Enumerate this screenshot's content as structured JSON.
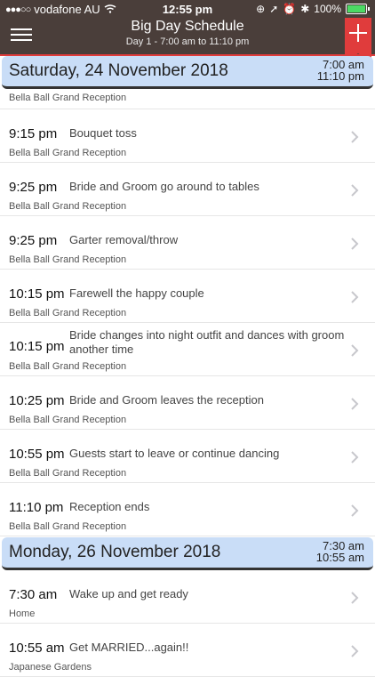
{
  "status": {
    "carrier": "vodafone AU",
    "time": "12:55 pm",
    "battery": "100%",
    "battery_color": "#4cd964"
  },
  "nav": {
    "title": "Big Day Schedule",
    "subtitle": "Day 1 - 7:00 am to 11:10 pm",
    "bar_color": "#4a3e3a",
    "add_color": "#e03c3c"
  },
  "day1": {
    "title": "Saturday, 24 November 2018",
    "start": "7:00 am",
    "end": "11:10 pm"
  },
  "day2": {
    "title": "Monday, 26 November 2018",
    "start": "7:30 am",
    "end": "10:55 am"
  },
  "rows": [
    {
      "time": "",
      "desc": "",
      "loc": "Bella Ball Grand Reception"
    },
    {
      "time": "9:15 pm",
      "desc": "Bouquet toss",
      "loc": "Bella Ball Grand Reception"
    },
    {
      "time": "9:25 pm",
      "desc": "Bride and Groom go around to tables",
      "loc": "Bella Ball Grand Reception"
    },
    {
      "time": "9:25 pm",
      "desc": "Garter removal/throw",
      "loc": "Bella Ball Grand Reception"
    },
    {
      "time": "10:15 pm",
      "desc": "Farewell the happy couple",
      "loc": "Bella Ball Grand Reception"
    },
    {
      "time": "10:15 pm",
      "desc": "Bride changes into night outfit and dances with groom another time",
      "loc": "Bella Ball Grand Reception"
    },
    {
      "time": "10:25 pm",
      "desc": "Bride and Groom leaves the reception",
      "loc": "Bella Ball Grand Reception"
    },
    {
      "time": "10:55 pm",
      "desc": "Guests start to leave or continue dancing",
      "loc": "Bella Ball Grand Reception"
    },
    {
      "time": "11:10 pm",
      "desc": "Reception ends",
      "loc": "Bella Ball Grand Reception"
    },
    {
      "time": "7:30 am",
      "desc": "Wake up and get ready",
      "loc": "Home"
    },
    {
      "time": "10:55 am",
      "desc": "Get MARRIED...again!!",
      "loc": "Japanese Gardens"
    }
  ]
}
